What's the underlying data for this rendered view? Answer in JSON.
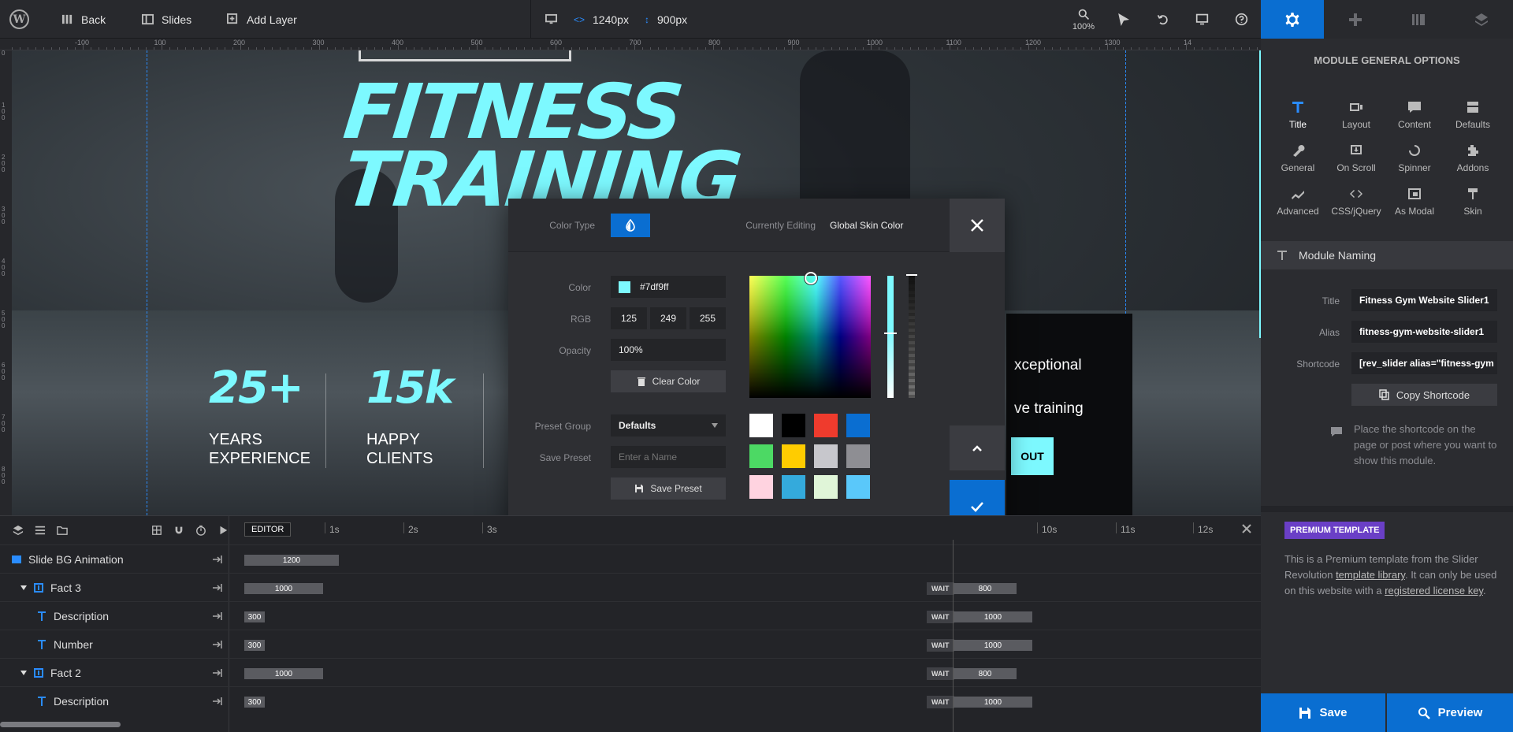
{
  "topbar": {
    "back_label": "Back",
    "slides_label": "Slides",
    "add_layer_label": "Add Layer",
    "width_value": "1240px",
    "height_value": "900px",
    "zoom_value": "100%"
  },
  "ruler": {
    "h_ticks": [
      "-100",
      "100",
      "200",
      "300",
      "400",
      "500",
      "600",
      "700",
      "800",
      "900",
      "1000",
      "1100",
      "1200",
      "1300",
      "14"
    ],
    "v_ticks": [
      "0",
      "1 0 0",
      "2 0 0",
      "3 0 0",
      "4 0 0",
      "5 0 0",
      "6 0 0",
      "7 0 0",
      "8 0 0"
    ]
  },
  "canvas": {
    "title_line1": "FITNESS",
    "title_line2": "TRAINING",
    "stat1_number": "25+",
    "stat1_label_line1": "YEARS",
    "stat1_label_line2": "EXPERIENCE",
    "stat2_number": "15k",
    "stat2_label_line1": "HAPPY",
    "stat2_label_line2": "CLIENTS",
    "card_text_line1": "xceptional",
    "card_text_line2": "ve training",
    "card_button": "OUT"
  },
  "color_picker": {
    "color_type_label": "Color Type",
    "currently_editing_label": "Currently Editing",
    "currently_editing_value": "Global Skin Color",
    "color_label": "Color",
    "color_hex": "#7df9ff",
    "rgb_label": "RGB",
    "r": "125",
    "g": "249",
    "b": "255",
    "opacity_label": "Opacity",
    "opacity_value": "100%",
    "clear_color_label": "Clear Color",
    "preset_group_label": "Preset Group",
    "preset_group_value": "Defaults",
    "save_preset_label": "Save Preset",
    "save_preset_placeholder": "Enter a Name",
    "save_preset_button": "Save Preset",
    "swatches": [
      "#ffffff",
      "#000000",
      "#ef3b2d",
      "#0a6ed1",
      "#4cd964",
      "#ffcc00",
      "#c7c7cc",
      "#8e8e93",
      "#ffd3e0",
      "#34aadc",
      "#e0f5d8",
      "#5ac8fa"
    ],
    "accent": "#0a6ed1"
  },
  "timeline": {
    "editor_label": "EDITOR",
    "seconds": [
      "1s",
      "2s",
      "3s",
      "10s",
      "11s",
      "12s"
    ],
    "rows": [
      {
        "name": "Slide BG Animation",
        "bar": "1200",
        "wait": "",
        "end": ""
      },
      {
        "name": "Fact 3",
        "bar": "1000",
        "wait": "WAIT",
        "end": "800"
      },
      {
        "name": "Description",
        "bar": "300",
        "wait": "WAIT",
        "end": "1000"
      },
      {
        "name": "Number",
        "bar": "300",
        "wait": "WAIT",
        "end": "1000"
      },
      {
        "name": "Fact 2",
        "bar": "1000",
        "wait": "WAIT",
        "end": "800"
      },
      {
        "name": "Description",
        "bar": "300",
        "wait": "WAIT",
        "end": "1000"
      }
    ]
  },
  "right_panel": {
    "title": "MODULE GENERAL OPTIONS",
    "grid": [
      "Title",
      "Layout",
      "Content",
      "Defaults",
      "General",
      "On Scroll",
      "Spinner",
      "Addons",
      "Advanced",
      "CSS/jQuery",
      "As Modal",
      "Skin"
    ],
    "section_title": "Module Naming",
    "title_label": "Title",
    "title_value": "Fitness Gym Website Slider1",
    "alias_label": "Alias",
    "alias_value": "fitness-gym-website-slider1",
    "shortcode_label": "Shortcode",
    "shortcode_value": "[rev_slider alias=\"fitness-gym",
    "copy_shortcode_label": "Copy Shortcode",
    "hint": "Place the shortcode on the page or post where you want to show this module.",
    "premium_badge": "PREMIUM TEMPLATE",
    "premium_text_1": "This is a Premium template from the Slider Revolution",
    "premium_link_1": "template library",
    "premium_text_2": ". It can only be used on this website with a",
    "premium_link_2": "registered license key",
    "premium_text_3": ".",
    "save_label": "Save",
    "preview_label": "Preview"
  }
}
